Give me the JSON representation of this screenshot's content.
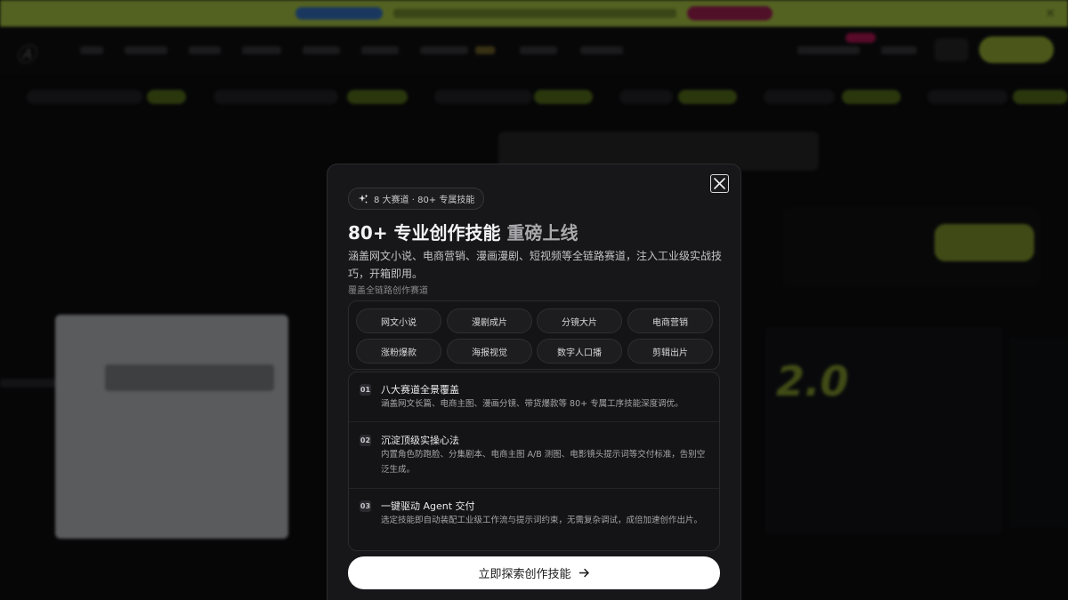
{
  "background": {
    "promo_close": "×"
  },
  "modal": {
    "chip_icon": "sparkles-icon",
    "chip_label": "8 大赛道 · 80+ 专属技能",
    "title_main": "80+ 专业创作技能",
    "title_highlight": "重磅上线",
    "description": "涵盖网文小说、电商营销、漫画漫剧、短视频等全链路赛道，注入工业级实战技巧，开箱即用。",
    "subheading": "覆盖全链路创作赛道",
    "categories": [
      "网文小说",
      "漫剧成片",
      "分镜大片",
      "电商营销",
      "涨粉爆款",
      "海报视觉",
      "数字人口播",
      "剪辑出片"
    ],
    "features": [
      {
        "num": "01",
        "title": "八大赛道全景覆盖",
        "text": "涵盖网文长篇、电商主图、漫画分镜、带货爆款等 80+ 专属工序技能深度调优。"
      },
      {
        "num": "02",
        "title": "沉淀顶级实操心法",
        "text": "内置角色防跑脸、分集剧本、电商主图 A/B 测图、电影镜头提示词等交付标准，告别空泛生成。"
      },
      {
        "num": "03",
        "title": "一键驱动 Agent 交付",
        "text": "选定技能即自动装配工业级工作流与提示词约束，无需复杂调试，成倍加速创作出片。"
      }
    ],
    "cta_label": "立即探索创作技能",
    "cta_icon": "arrow-right-icon",
    "close_icon": "close-icon"
  }
}
